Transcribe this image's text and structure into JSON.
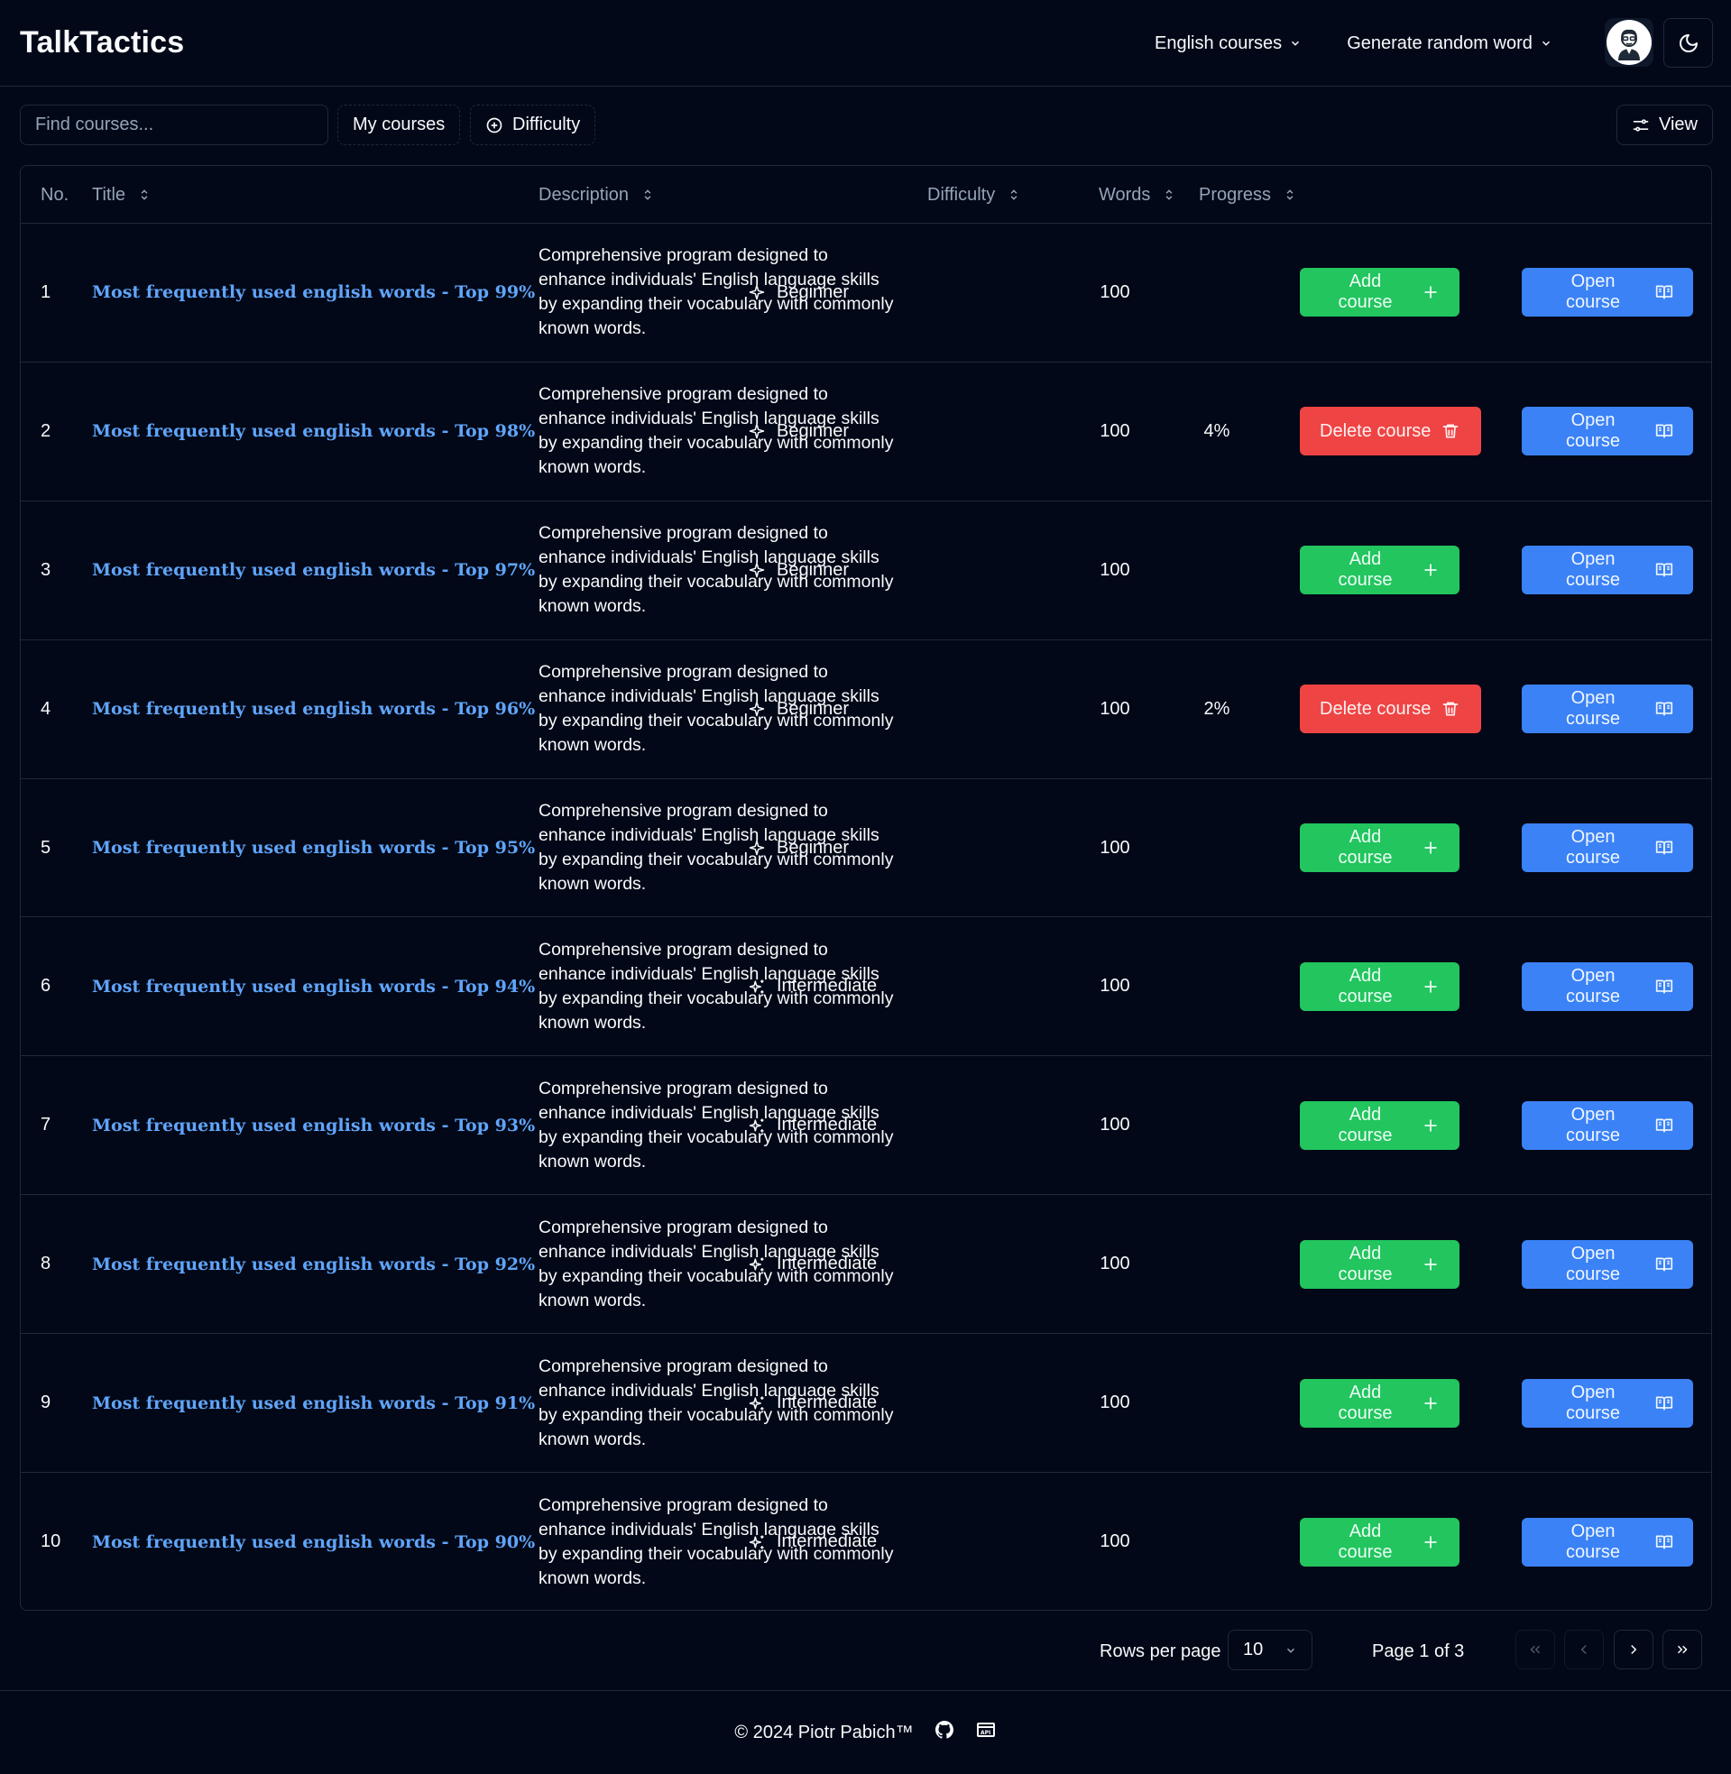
{
  "brand": "TalkTactics",
  "nav": {
    "courses": "English courses",
    "random_word": "Generate random word"
  },
  "toolbar": {
    "search_placeholder": "Find courses...",
    "my_courses": "My courses",
    "difficulty": "Difficulty",
    "view": "View"
  },
  "table": {
    "headers": {
      "no": "No.",
      "title": "Title",
      "description": "Description",
      "difficulty": "Difficulty",
      "words": "Words",
      "progress": "Progress"
    },
    "rows": [
      {
        "no": "1",
        "title": "Most frequently used english words - Top 99%",
        "description": "Comprehensive program designed to enhance individuals' English language skills by expanding their vocabulary with commonly known words.",
        "difficulty": "Beginner",
        "words": "100",
        "progress": "",
        "action": "Add course",
        "open": "Open course"
      },
      {
        "no": "2",
        "title": "Most frequently used english words - Top 98%",
        "description": "Comprehensive program designed to enhance individuals' English language skills by expanding their vocabulary with commonly known words.",
        "difficulty": "Beginner",
        "words": "100",
        "progress": "4%",
        "action": "Delete course",
        "open": "Open course"
      },
      {
        "no": "3",
        "title": "Most frequently used english words - Top 97%",
        "description": "Comprehensive program designed to enhance individuals' English language skills by expanding their vocabulary with commonly known words.",
        "difficulty": "Beginner",
        "words": "100",
        "progress": "",
        "action": "Add course",
        "open": "Open course"
      },
      {
        "no": "4",
        "title": "Most frequently used english words - Top 96%",
        "description": "Comprehensive program designed to enhance individuals' English language skills by expanding their vocabulary with commonly known words.",
        "difficulty": "Beginner",
        "words": "100",
        "progress": "2%",
        "action": "Delete course",
        "open": "Open course"
      },
      {
        "no": "5",
        "title": "Most frequently used english words - Top 95%",
        "description": "Comprehensive program designed to enhance individuals' English language skills by expanding their vocabulary with commonly known words.",
        "difficulty": "Beginner",
        "words": "100",
        "progress": "",
        "action": "Add course",
        "open": "Open course"
      },
      {
        "no": "6",
        "title": "Most frequently used english words - Top 94%",
        "description": "Comprehensive program designed to enhance individuals' English language skills by expanding their vocabulary with commonly known words.",
        "difficulty": "Intermediate",
        "words": "100",
        "progress": "",
        "action": "Add course",
        "open": "Open course"
      },
      {
        "no": "7",
        "title": "Most frequently used english words - Top 93%",
        "description": "Comprehensive program designed to enhance individuals' English language skills by expanding their vocabulary with commonly known words.",
        "difficulty": "Intermediate",
        "words": "100",
        "progress": "",
        "action": "Add course",
        "open": "Open course"
      },
      {
        "no": "8",
        "title": "Most frequently used english words - Top 92%",
        "description": "Comprehensive program designed to enhance individuals' English language skills by expanding their vocabulary with commonly known words.",
        "difficulty": "Intermediate",
        "words": "100",
        "progress": "",
        "action": "Add course",
        "open": "Open course"
      },
      {
        "no": "9",
        "title": "Most frequently used english words - Top 91%",
        "description": "Comprehensive program designed to enhance individuals' English language skills by expanding their vocabulary with commonly known words.",
        "difficulty": "Intermediate",
        "words": "100",
        "progress": "",
        "action": "Add course",
        "open": "Open course"
      },
      {
        "no": "10",
        "title": "Most frequently used english words - Top 90%",
        "description": "Comprehensive program designed to enhance individuals' English language skills by expanding their vocabulary with commonly known words.",
        "difficulty": "Intermediate",
        "words": "100",
        "progress": "",
        "action": "Add course",
        "open": "Open course"
      }
    ]
  },
  "pagination": {
    "rows_per_page_label": "Rows per page",
    "rows_per_page": "10",
    "page_info": "Page 1 of 3"
  },
  "footer": {
    "copyright": "© 2024 Piotr Pabich™"
  },
  "colors": {
    "background": "#020817",
    "border": "#1e293b",
    "title_link": "#60a5fa",
    "add": "#22c55e",
    "delete": "#ef4444",
    "open": "#3b82f6"
  }
}
